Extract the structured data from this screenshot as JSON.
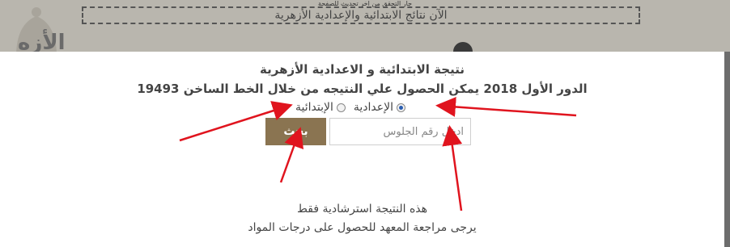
{
  "background": {
    "top_note": "جار التحقق من اخر تحديث للصفحة",
    "banner_text": "الآن نتائج الابتدائية والإعدادية الأزهرية",
    "big_text": "الأزه"
  },
  "modal": {
    "title": "نتيجة الابتدائية و الاعدادية الأزهرية",
    "subtitle": "الدور الأول 2018 يمكن الحصول علي النتيجه من خلال الخط الساخن 19493",
    "radio_options": [
      {
        "label": "الإبتدائية",
        "checked": false
      },
      {
        "label": "الإعدادية",
        "checked": true
      }
    ],
    "search_button": "بحث",
    "seat_input": {
      "value": "",
      "placeholder": "ادخل رقم الجلوس"
    },
    "note_line1": "هذه النتيجة استرشادية فقط",
    "note_line2": "يرجى مراجعة المعهد للحصول على درجات المواد"
  },
  "colors": {
    "button": "#8a7451",
    "annotation_arrow": "#e0141e",
    "overlay": "#8c8c8c"
  }
}
